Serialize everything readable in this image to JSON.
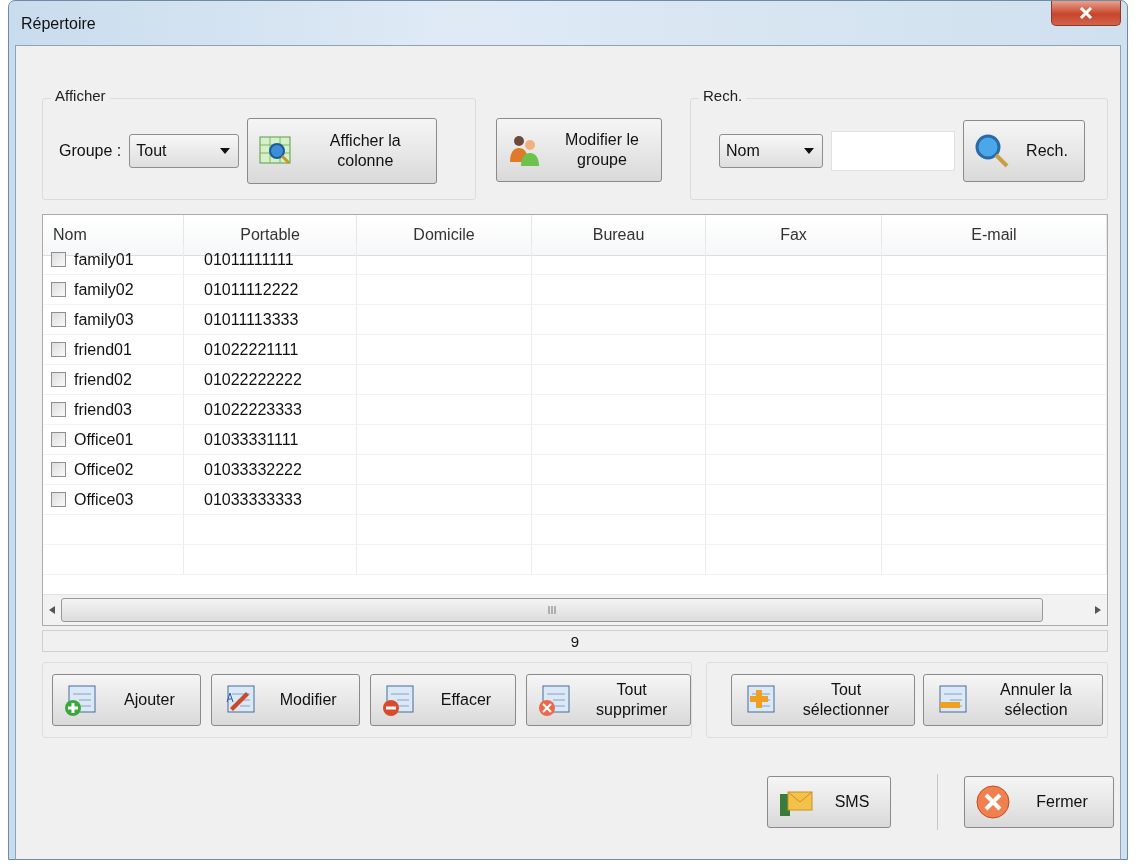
{
  "window": {
    "title": "Répertoire"
  },
  "display_group": {
    "legend": "Afficher",
    "group_label": "Groupe :",
    "group_select": "Tout",
    "show_columns_button": {
      "label": "Afficher la colonne",
      "kind": "columns"
    }
  },
  "modify_group_button": {
    "label": "Modifier le groupe",
    "kind": "people"
  },
  "search_group": {
    "legend": "Rech.",
    "field_select": "Nom",
    "search_button": {
      "label": "Rech.",
      "kind": "search"
    }
  },
  "table": {
    "columns": [
      "Nom",
      "Portable",
      "Domicile",
      "Bureau",
      "Fax",
      "E-mail"
    ],
    "rows": [
      {
        "name": "family01",
        "portable": "01011111111",
        "checked": false
      },
      {
        "name": "family02",
        "portable": "01011112222",
        "checked": false
      },
      {
        "name": "family03",
        "portable": "01011113333",
        "checked": false
      },
      {
        "name": "friend01",
        "portable": "01022221111",
        "checked": false
      },
      {
        "name": "friend02",
        "portable": "01022222222",
        "checked": false
      },
      {
        "name": "friend03",
        "portable": "01022223333",
        "checked": false
      },
      {
        "name": "Office01",
        "portable": "01033331111",
        "checked": false
      },
      {
        "name": "Office02",
        "portable": "01033332222",
        "checked": false
      },
      {
        "name": "Office03",
        "portable": "01033333333",
        "checked": false
      }
    ]
  },
  "status_bar": "9",
  "edit_buttons": [
    {
      "label": "Ajouter",
      "kind": "add"
    },
    {
      "label": "Modifier",
      "kind": "edit"
    },
    {
      "label": "Effacer",
      "kind": "delete"
    },
    {
      "label": "Tout supprimer",
      "kind": "delete_all"
    }
  ],
  "selection_buttons": [
    {
      "label": "Tout sélectionner",
      "kind": "select_all"
    },
    {
      "label": "Annuler la sélection",
      "kind": "deselect"
    }
  ],
  "footer_buttons": [
    {
      "label": "SMS",
      "kind": "sms"
    },
    {
      "label": "Fermer",
      "kind": "close"
    }
  ]
}
